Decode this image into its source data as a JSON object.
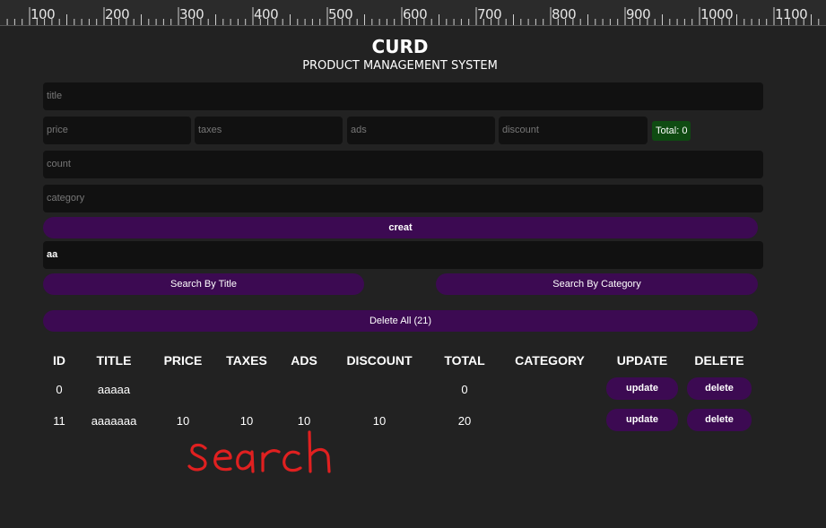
{
  "ruler": {
    "labels": [
      "100",
      "200",
      "300",
      "400",
      "500",
      "600",
      "700",
      "800",
      "900",
      "1000",
      "1100"
    ]
  },
  "app": {
    "title": "CURD",
    "subtitle": "PRODUCT MANAGEMENT SYSTEM"
  },
  "form": {
    "title_placeholder": "title",
    "price_placeholder": "price",
    "taxes_placeholder": "taxes",
    "ads_placeholder": "ads",
    "discount_placeholder": "discount",
    "total_label": "Total: 0",
    "count_placeholder": "count",
    "category_placeholder": "category",
    "create_label": "creat"
  },
  "search": {
    "value": "aa",
    "by_title_label": "Search By Title",
    "by_category_label": "Search By Category",
    "delete_all_label": "Delete All (21)"
  },
  "table": {
    "headers": [
      "ID",
      "TITLE",
      "PRICE",
      "TAXES",
      "ADS",
      "DISCOUNT",
      "TOTAL",
      "CATEGORY",
      "UPDATE",
      "DELETE"
    ],
    "rows": [
      {
        "id": "0",
        "title": "aaaaa",
        "price": "",
        "taxes": "",
        "ads": "",
        "discount": "",
        "total": "0",
        "category": "",
        "update": "update",
        "delete": "delete"
      },
      {
        "id": "11",
        "title": "aaaaaaa",
        "price": "10",
        "taxes": "10",
        "ads": "10",
        "discount": "10",
        "total": "20",
        "category": "",
        "update": "update",
        "delete": "delete"
      }
    ]
  },
  "annotation": {
    "handwritten_text": "search",
    "color": "#e02020"
  },
  "colors": {
    "background": "#222222",
    "input": "#111111",
    "button": "#3c0a52",
    "total_badge": "#0f4b12"
  }
}
